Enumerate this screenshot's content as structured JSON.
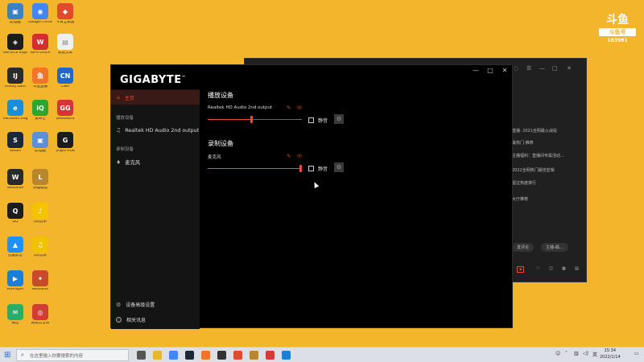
{
  "desktop_icons": [
    {
      "label": "此电脑",
      "icon": "computer-icon",
      "color": "#3b82c4",
      "glyph": "▣"
    },
    {
      "label": "Google Chrome",
      "icon": "chrome-icon",
      "color": "#4285f4",
      "glyph": "◉"
    },
    {
      "label": "今日全知道",
      "icon": "app-icon",
      "color": "#e24a2c",
      "glyph": "◆"
    },
    {
      "label": "GeForce Experience",
      "icon": "nvidia-icon",
      "color": "#1c1c1c",
      "glyph": "◈"
    },
    {
      "label": "WPS Office",
      "icon": "wps-icon",
      "color": "#d42e2e",
      "glyph": "W"
    },
    {
      "label": "新建文本",
      "icon": "text-file-icon",
      "color": "#f0f0f0",
      "glyph": "▤"
    },
    {
      "label": "IntelliJ IDEA",
      "icon": "intellij-icon",
      "color": "#2b2b2b",
      "glyph": "IJ"
    },
    {
      "label": "斗鱼直播",
      "icon": "douyu-icon",
      "color": "#f27428",
      "glyph": "鱼"
    },
    {
      "label": "CNKI",
      "icon": "cnki-icon",
      "color": "#2067c8",
      "glyph": "CN"
    },
    {
      "label": "Microsoft Edge",
      "icon": "edge-icon",
      "color": "#1a8fd8",
      "glyph": "e"
    },
    {
      "label": "爱奇艺",
      "icon": "iqiyi-icon",
      "color": "#2ba82b",
      "glyph": "iQ"
    },
    {
      "label": "GeoGebra",
      "icon": "app-icon",
      "color": "#d43636",
      "glyph": "GG"
    },
    {
      "label": "Steam",
      "icon": "steam-icon",
      "color": "#1b2838",
      "glyph": "S"
    },
    {
      "label": "此电脑",
      "icon": "computer-icon",
      "color": "#5b8fd9",
      "glyph": "▣"
    },
    {
      "label": "罗技G HUB",
      "icon": "logitech-icon",
      "color": "#1c1c1c",
      "glyph": "G"
    },
    {
      "label": "WeGame",
      "icon": "wegame-icon",
      "color": "#2a2a2a",
      "glyph": "W"
    },
    {
      "label": "英雄联盟",
      "icon": "game-icon",
      "color": "#b8862b",
      "glyph": "L"
    },
    {
      "label": "QQ",
      "icon": "qq-icon",
      "color": "#1c1c1c",
      "glyph": "Q"
    },
    {
      "label": "QQ音乐",
      "icon": "qqmusic-icon",
      "color": "#f5c400",
      "glyph": "♪"
    },
    {
      "label": "迅雷影音",
      "icon": "xunlei-icon",
      "color": "#1e90ff",
      "glyph": "▲"
    },
    {
      "label": "QQ音乐",
      "icon": "music-icon",
      "color": "#f2c200",
      "glyph": "♫"
    },
    {
      "label": "PotPlayer",
      "icon": "potplayer-icon",
      "color": "#1c7ed6",
      "glyph": "▶"
    },
    {
      "label": "WeGame",
      "icon": "game-icon",
      "color": "#c94a2a",
      "glyph": "✦"
    },
    {
      "label": "微信",
      "icon": "wechat-icon",
      "color": "#2aae67",
      "glyph": "✉"
    },
    {
      "label": "网易云音乐",
      "icon": "netease-icon",
      "color": "#d43c33",
      "glyph": "◎"
    }
  ],
  "watermark": {
    "line1": "斗鱼",
    "line2": "斗鱼号",
    "line3": "183981"
  },
  "background_window": {
    "rows": [
      "直播· 2021全网最火战役",
      "最热门·推荐",
      "主播福利：直播间专属活动...",
      "2022全网热门最佳剪辑",
      "超过热度排行",
      "大厅推荐"
    ],
    "input_label": "发评论",
    "user_label": "主播-橘..."
  },
  "window": {
    "brand": "GIGABYTE",
    "min": "—",
    "max": "□",
    "close": "✕"
  },
  "sidebar": {
    "home_label": "主页",
    "playback_section": "播放设备",
    "playback_device": "Realtek HD Audio 2nd output",
    "record_section": "录制设备",
    "record_device": "麦克风",
    "advanced_label": "设备高级设置",
    "about_label": "相关讯息"
  },
  "playback": {
    "title": "播放设备",
    "device_name": "Realtek HD Audio 2nd output",
    "volume": 45,
    "mute_label": "静音",
    "muted": false
  },
  "recording": {
    "title": "录制设备",
    "device_name": "麦克风",
    "volume": 100,
    "mute_label": "静音",
    "muted": false
  },
  "taskbar": {
    "search_placeholder": "在这里输入你要搜索的内容",
    "time": "15:34",
    "date": "2022/1/14",
    "apps": [
      {
        "icon": "task-view-icon",
        "color": "#555"
      },
      {
        "icon": "file-explorer-icon",
        "color": "#e8b730"
      },
      {
        "icon": "chrome-icon",
        "color": "#4285f4"
      },
      {
        "icon": "steam-icon",
        "color": "#1b2838"
      },
      {
        "icon": "douyu-icon",
        "color": "#f27428"
      },
      {
        "icon": "app-icon",
        "color": "#333"
      },
      {
        "icon": "app-icon",
        "color": "#e24a2c"
      },
      {
        "icon": "game-icon",
        "color": "#b8862b"
      },
      {
        "icon": "netease-icon",
        "color": "#d43c33"
      },
      {
        "icon": "app-icon",
        "color": "#1c7ed6"
      }
    ]
  }
}
